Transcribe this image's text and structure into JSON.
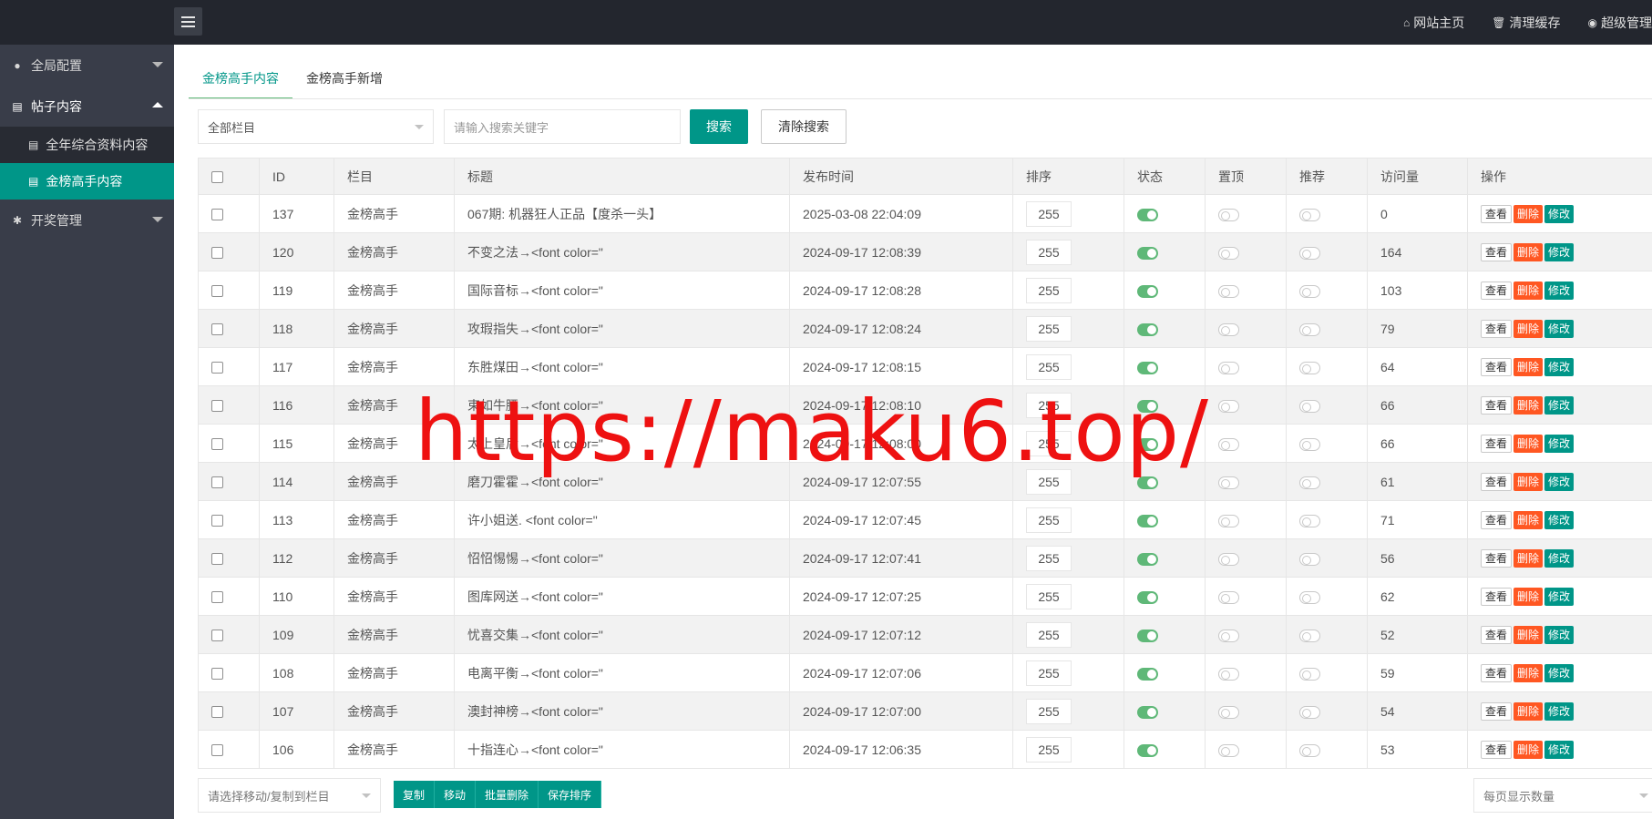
{
  "header": {
    "links": [
      {
        "icon": "home-icon",
        "glyph": "⌂",
        "label": "网站主页"
      },
      {
        "icon": "trash-icon",
        "glyph": "🗑",
        "label": "清理缓存"
      },
      {
        "icon": "user-icon",
        "glyph": "◉",
        "label": "超级管理"
      }
    ]
  },
  "sidebar": {
    "items": [
      {
        "icon": "globe-icon",
        "glyph": "●",
        "label": "全局配置",
        "expanded": false
      },
      {
        "icon": "document-icon",
        "glyph": "▤",
        "label": "帖子内容",
        "expanded": true,
        "children": [
          {
            "icon": "document-icon",
            "glyph": "▤",
            "label": "全年综合资料内容",
            "active": false
          },
          {
            "icon": "document-icon",
            "glyph": "▤",
            "label": "金榜高手内容",
            "active": true
          }
        ]
      },
      {
        "icon": "gear-icon",
        "glyph": "✱",
        "label": "开奖管理",
        "expanded": false
      }
    ]
  },
  "tabs": [
    {
      "label": "金榜高手内容",
      "active": true
    },
    {
      "label": "金榜高手新增",
      "active": false
    }
  ],
  "filter": {
    "category_value": "全部栏目",
    "search_placeholder": "请输入搜索关键字",
    "search_label": "搜索",
    "clear_label": "清除搜索"
  },
  "table": {
    "columns": [
      "ID",
      "栏目",
      "标题",
      "发布时间",
      "排序",
      "状态",
      "置顶",
      "推荐",
      "访问量",
      "操作"
    ],
    "actions": {
      "view": "查看",
      "delete": "删除",
      "edit": "修改"
    },
    "rows": [
      {
        "id": "137",
        "category": "金榜高手",
        "title": "067期: 机器狂人正品【度杀一头】",
        "time": "2025-03-08 22:04:09",
        "sort": "255",
        "status": true,
        "top": false,
        "recommend": false,
        "views": "0"
      },
      {
        "id": "120",
        "category": "金榜高手",
        "title": "不变之法→<font color=\"",
        "time": "2024-09-17 12:08:39",
        "sort": "255",
        "status": true,
        "top": false,
        "recommend": false,
        "views": "164"
      },
      {
        "id": "119",
        "category": "金榜高手",
        "title": "国际音标→<font color=\"",
        "time": "2024-09-17 12:08:28",
        "sort": "255",
        "status": true,
        "top": false,
        "recommend": false,
        "views": "103"
      },
      {
        "id": "118",
        "category": "金榜高手",
        "title": "攻瑕指失→<font color=\"",
        "time": "2024-09-17 12:08:24",
        "sort": "255",
        "status": true,
        "top": false,
        "recommend": false,
        "views": "79"
      },
      {
        "id": "117",
        "category": "金榜高手",
        "title": "东胜煤田→<font color=\"",
        "time": "2024-09-17 12:08:15",
        "sort": "255",
        "status": true,
        "top": false,
        "recommend": false,
        "views": "64"
      },
      {
        "id": "116",
        "category": "金榜高手",
        "title": "束如牛腰→<font color=\"",
        "time": "2024-09-17 12:08:10",
        "sort": "255",
        "status": true,
        "top": false,
        "recommend": false,
        "views": "66"
      },
      {
        "id": "115",
        "category": "金榜高手",
        "title": "太上皇后→<font color=\"",
        "time": "2024-09-17 12:08:00",
        "sort": "255",
        "status": true,
        "top": false,
        "recommend": false,
        "views": "66"
      },
      {
        "id": "114",
        "category": "金榜高手",
        "title": "磨刀霍霍→<font color=\"",
        "time": "2024-09-17 12:07:55",
        "sort": "255",
        "status": true,
        "top": false,
        "recommend": false,
        "views": "61"
      },
      {
        "id": "113",
        "category": "金榜高手",
        "title": "许小姐送. <font color=\"",
        "time": "2024-09-17 12:07:45",
        "sort": "255",
        "status": true,
        "top": false,
        "recommend": false,
        "views": "71"
      },
      {
        "id": "112",
        "category": "金榜高手",
        "title": "怊怊惕惕→<font color=\"",
        "time": "2024-09-17 12:07:41",
        "sort": "255",
        "status": true,
        "top": false,
        "recommend": false,
        "views": "56"
      },
      {
        "id": "110",
        "category": "金榜高手",
        "title": "图库网送→<font color=\"",
        "time": "2024-09-17 12:07:25",
        "sort": "255",
        "status": true,
        "top": false,
        "recommend": false,
        "views": "62"
      },
      {
        "id": "109",
        "category": "金榜高手",
        "title": "忧喜交集→<font color=\"",
        "time": "2024-09-17 12:07:12",
        "sort": "255",
        "status": true,
        "top": false,
        "recommend": false,
        "views": "52"
      },
      {
        "id": "108",
        "category": "金榜高手",
        "title": "电离平衡→<font color=\"",
        "time": "2024-09-17 12:07:06",
        "sort": "255",
        "status": true,
        "top": false,
        "recommend": false,
        "views": "59"
      },
      {
        "id": "107",
        "category": "金榜高手",
        "title": "澳封神榜→<font color=\"",
        "time": "2024-09-17 12:07:00",
        "sort": "255",
        "status": true,
        "top": false,
        "recommend": false,
        "views": "54"
      },
      {
        "id": "106",
        "category": "金榜高手",
        "title": "十指连心→<font color=\"",
        "time": "2024-09-17 12:06:35",
        "sort": "255",
        "status": true,
        "top": false,
        "recommend": false,
        "views": "53"
      }
    ]
  },
  "bottom": {
    "move_placeholder": "请选择移动/复制到栏目",
    "buttons": [
      "复制",
      "移动",
      "批量删除",
      "保存排序"
    ],
    "per_page_placeholder": "每页显示数量"
  },
  "watermark": "https://maku6.top/",
  "colors": {
    "accent": "#009688",
    "danger": "#ff5722",
    "toggle_on": "#5fb878",
    "topbar": "#23262e",
    "sidebar": "#393d49"
  }
}
